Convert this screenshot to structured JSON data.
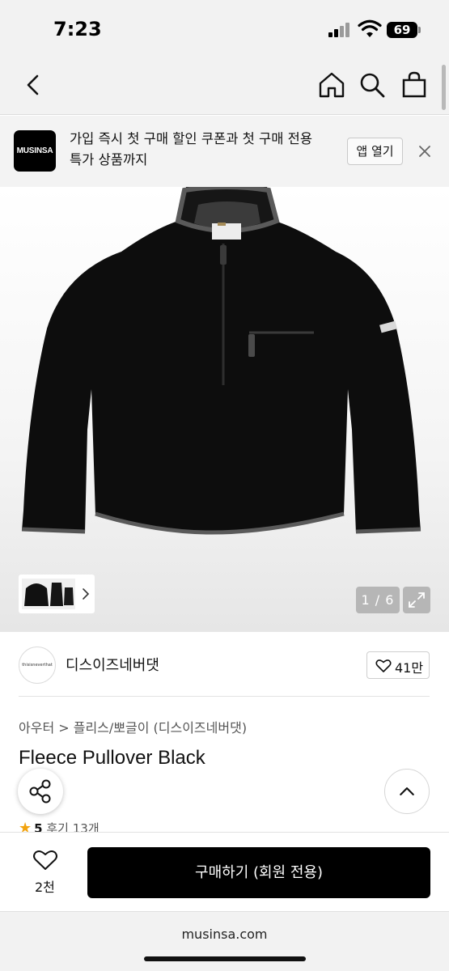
{
  "status_bar": {
    "time": "7:23",
    "battery": "69"
  },
  "nav": {
    "icons": [
      "back-icon",
      "home-icon",
      "search-icon",
      "bag-icon"
    ]
  },
  "banner": {
    "logo_text": "MUSINSA",
    "line1": "가입 즉시 첫 구매 할인 쿠폰과 첫 구매 전용",
    "line2": "특가 상품까지",
    "open_label": "앱 열기"
  },
  "gallery": {
    "page_indicator": "1 / 6"
  },
  "brand": {
    "logo_text": "thisisneverthat",
    "name": "디스이즈네버댓",
    "likes": "41만"
  },
  "product": {
    "breadcrumb": "아우터 > 플리스/뽀글이 (디스이즈네버댓)",
    "title": "Fleece Pullover Black",
    "rating_score": "5",
    "review_text": "후기 13개"
  },
  "purchase": {
    "wish_count": "2천",
    "buy_label": "구매하기 (회원 전용)"
  },
  "browser": {
    "url": "musinsa.com"
  },
  "colors": {
    "accent": "#000000",
    "star": "#f2a30f"
  }
}
